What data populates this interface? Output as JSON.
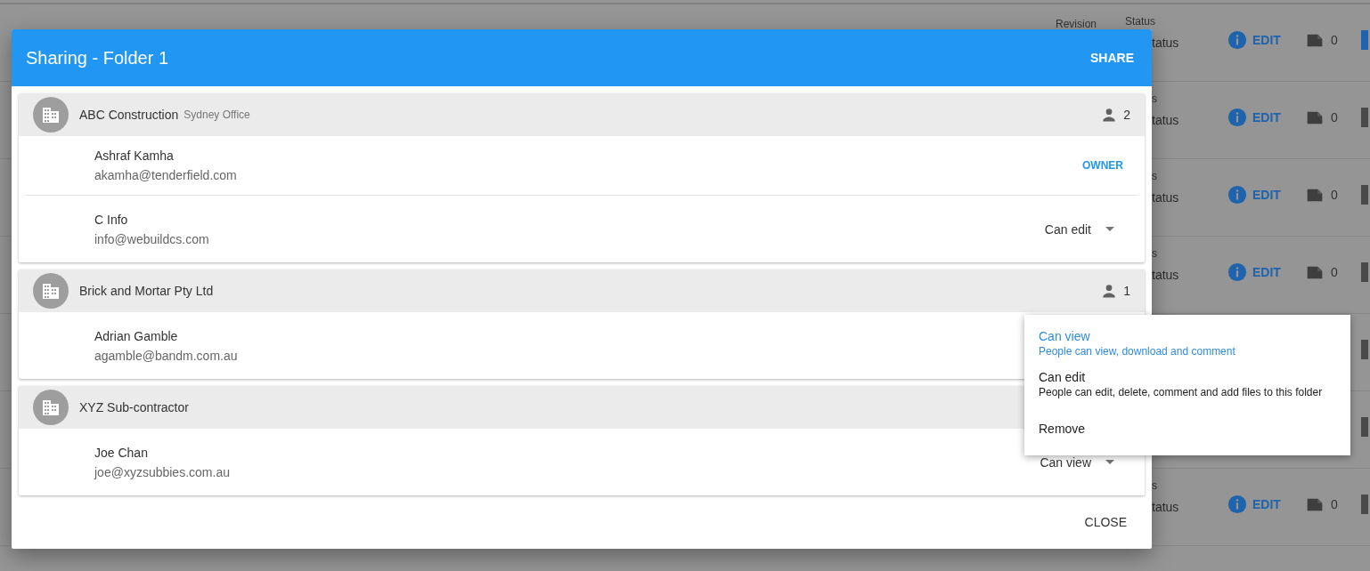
{
  "background_rows": [
    {
      "revision_header": "Revision",
      "status_header": "Status",
      "status_value": "tatus",
      "action": "EDIT",
      "count": "0",
      "color": "#1e63ad"
    },
    {
      "status_header": "s",
      "status_value": "tatus",
      "action": "EDIT",
      "count": "0",
      "color": "#4a4a4a"
    },
    {
      "status_header": "s",
      "status_value": "tatus",
      "action": "EDIT",
      "count": "0",
      "color": "#4a4a4a"
    },
    {
      "status_header": "s",
      "status_value": "tatus",
      "action": "EDIT",
      "count": "0",
      "color": "#4a4a4a"
    },
    {
      "color": "#4a4a4a"
    },
    {
      "color": "#4a4a4a"
    },
    {
      "status_header": "s",
      "status_value": "tatus",
      "action": "EDIT",
      "count": "0",
      "color": "#4a4a4a"
    }
  ],
  "dialog": {
    "title": "Sharing - Folder 1",
    "share_button": "SHARE",
    "close_button": "CLOSE",
    "groups": [
      {
        "name": "ABC Construction",
        "office": "Sydney Office",
        "count": "2",
        "members": [
          {
            "name": "Ashraf Kamha",
            "email": "akamha@tenderfield.com",
            "kind": "owner",
            "role": "OWNER"
          },
          {
            "name": "C Info",
            "email": "info@webuildcs.com",
            "kind": "select",
            "role": "Can edit"
          }
        ]
      },
      {
        "name": "Brick and Mortar Pty Ltd",
        "count": "1",
        "members": [
          {
            "name": "Adrian Gamble",
            "email": "agamble@bandm.com.au",
            "kind": "none"
          }
        ]
      },
      {
        "name": "XYZ Sub-contractor",
        "members": [
          {
            "name": "Joe Chan",
            "email": "joe@xyzsubbies.com.au",
            "kind": "select",
            "role": "Can view"
          }
        ]
      }
    ]
  },
  "role_menu": [
    {
      "label": "Can view",
      "description": "People can view, download and comment",
      "selected": true
    },
    {
      "label": "Can edit",
      "description": "People can edit, delete, comment and add files to this folder",
      "selected": false
    },
    {
      "label": "Remove",
      "selected": false
    }
  ]
}
